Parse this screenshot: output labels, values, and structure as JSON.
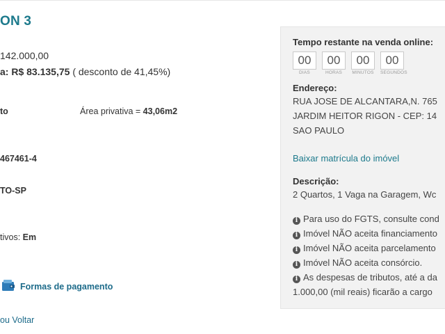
{
  "title": "ON 3",
  "left": {
    "price": "142.000,00",
    "min_sale_prefix": "a:",
    "min_sale_value": "R$ 83.135,75",
    "discount": "( desconto de 41,45%)",
    "type_fragment": "to",
    "area_label": "Área privativa = ",
    "area_value": "43,06m2",
    "registration_fragment": "467461-4",
    "city_fragment": "TO-SP",
    "status_label": "tivos: ",
    "status_value": "Em",
    "payment_link": "Formas de pagamento",
    "back_link": "ou Voltar"
  },
  "panel": {
    "countdown_title": "Tempo restante na venda online:",
    "countdown": [
      {
        "value": "00",
        "label": "DIAS"
      },
      {
        "value": "00",
        "label": "HORAS"
      },
      {
        "value": "00",
        "label": "MINUTOS"
      },
      {
        "value": "00",
        "label": "SEGUNDOS"
      }
    ],
    "address_title": "Endereço:",
    "address_line1": "RUA JOSE DE ALCANTARA,N. 765",
    "address_line2": "JARDIM HEITOR RIGON - CEP: 14",
    "address_line3": "SAO PAULO",
    "matricula_link": "Baixar matrícula do imóvel",
    "description_title": "Descrição:",
    "description_text": "2 Quartos, 1 Vaga na Garagem, Wc",
    "notes": [
      "Para uso do FGTS, consulte cond",
      "Imóvel NÃO aceita financiamento",
      "Imóvel NÃO aceita parcelamento",
      "Imóvel NÃO aceita consórcio.",
      "As despesas de tributos, até a da"
    ],
    "notes_continuation": "1.000,00 (mil reais) ficarão a cargo"
  },
  "icons": {
    "payment": "wallet-icon",
    "info": "info-circle-icon"
  }
}
